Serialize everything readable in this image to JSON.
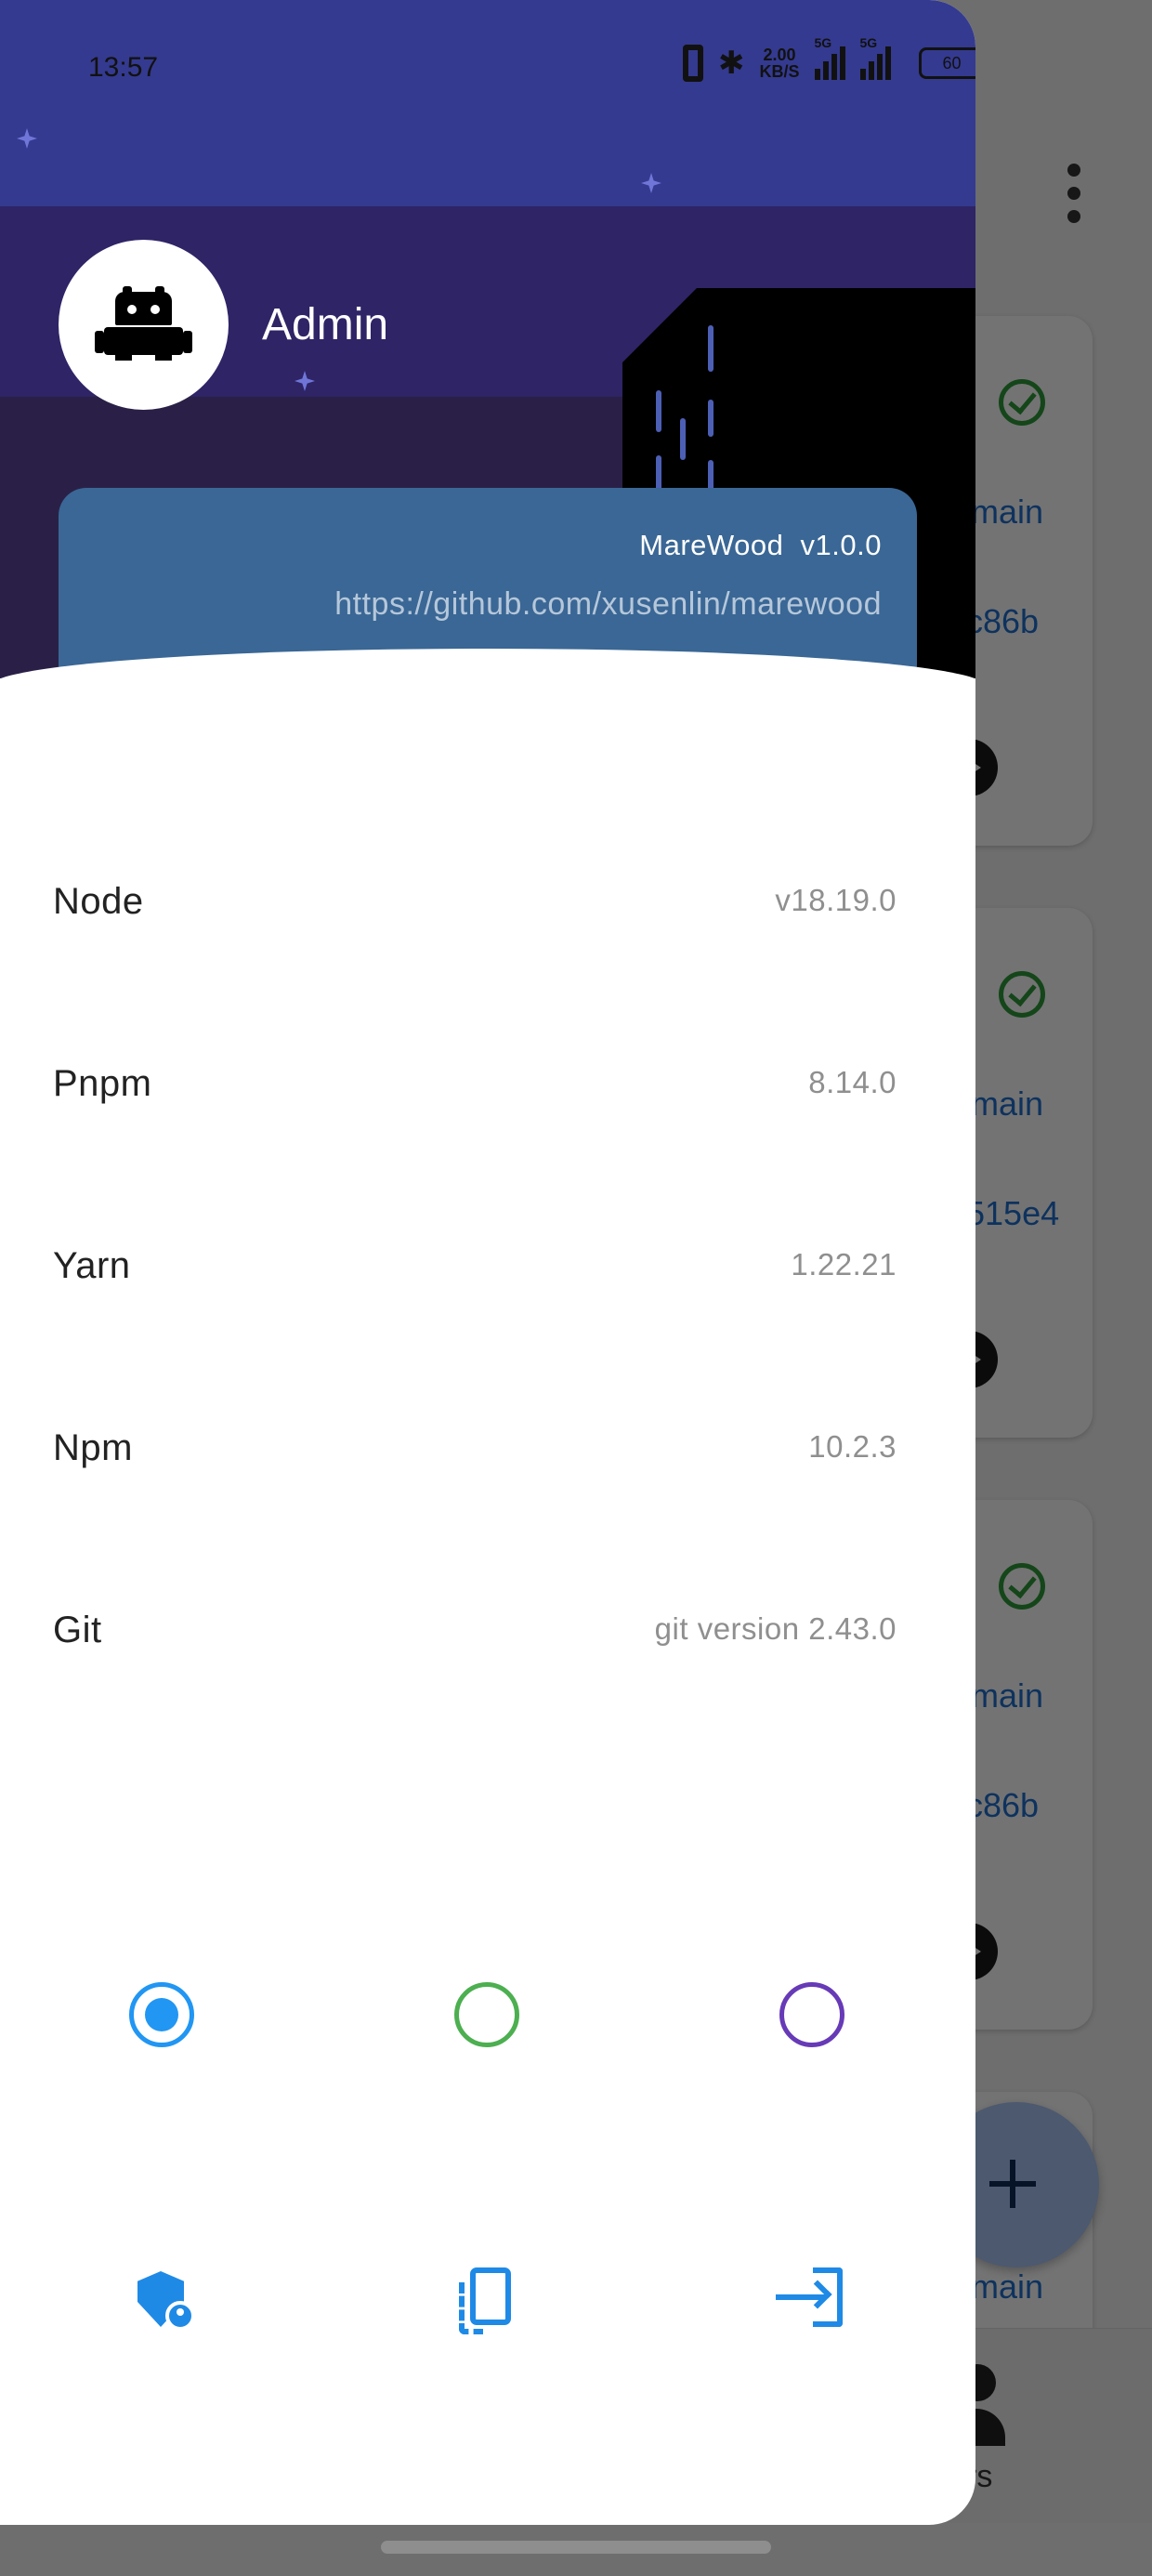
{
  "status_bar": {
    "time": "13:57",
    "speed": "2.00",
    "speed_unit": "KB/S",
    "net1": "5G",
    "net2": "5G",
    "battery": "60"
  },
  "drawer": {
    "username": "Admin",
    "app_version": "MareWood  v1.0.0",
    "repo_link": "https://github.com/xusenlin/marewood",
    "info": [
      {
        "label": "Node",
        "value": "v18.19.0"
      },
      {
        "label": "Pnpm",
        "value": "8.14.0"
      },
      {
        "label": "Yarn",
        "value": "1.22.21"
      },
      {
        "label": "Npm",
        "value": "10.2.3"
      },
      {
        "label": "Git",
        "value": "git version 2.43.0"
      }
    ],
    "themes": [
      {
        "name": "theme-blue",
        "color": "#2196f3",
        "selected": true
      },
      {
        "name": "theme-green",
        "color": "#4caf50",
        "selected": false
      },
      {
        "name": "theme-purple",
        "color": "#673ab7",
        "selected": false
      }
    ],
    "actions": [
      "admin-shield-icon",
      "device-icon",
      "login-icon"
    ]
  },
  "background": {
    "cards": [
      {
        "branch": "main",
        "hash": "c86b"
      },
      {
        "branch": "main",
        "hash": "515e4"
      },
      {
        "branch": "main",
        "hash": "c86b"
      }
    ],
    "fab_branch": "main",
    "nav_label": "rs"
  }
}
